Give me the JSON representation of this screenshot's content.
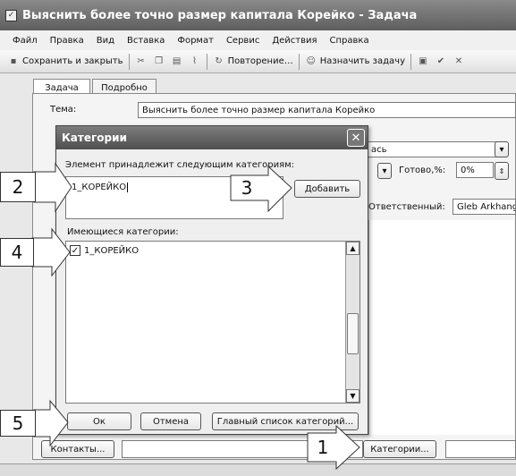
{
  "window": {
    "title": "Выяснить более точно размер капитала Корейко - Задача"
  },
  "menu": [
    "Файл",
    "Правка",
    "Вид",
    "Вставка",
    "Формат",
    "Сервис",
    "Действия",
    "Справка"
  ],
  "toolbar": {
    "save_close": "Сохранить и закрыть",
    "recurrence": "Повторение…",
    "assign": "Назначить задачу"
  },
  "tabs": [
    "Задача",
    "Подробно"
  ],
  "form": {
    "subject_label": "Тема:",
    "subject_value": "Выяснить более точно размер капитала Корейко",
    "status_partial": "ась",
    "done_label": "Готово,%:",
    "done_value": "0%",
    "owner_label": "Ответственный:",
    "owner_value": "Gleb Arkhang",
    "contacts_button": "Контакты...",
    "categories_button": "Категории..."
  },
  "dialog": {
    "title": "Категории",
    "belongs_label": "Элемент принадлежит следующим категориям:",
    "belongs_value": "1_КОРЕЙКО",
    "add_button": "Добавить",
    "available_label": "Имеющиеся категории:",
    "items": [
      {
        "label": "1_КОРЕЙКО",
        "checked": true
      }
    ],
    "ok_button": "Ок",
    "cancel_button": "Отмена",
    "master_button": "Главный список категорий..."
  },
  "callouts": [
    "1",
    "2",
    "3",
    "4",
    "5"
  ]
}
